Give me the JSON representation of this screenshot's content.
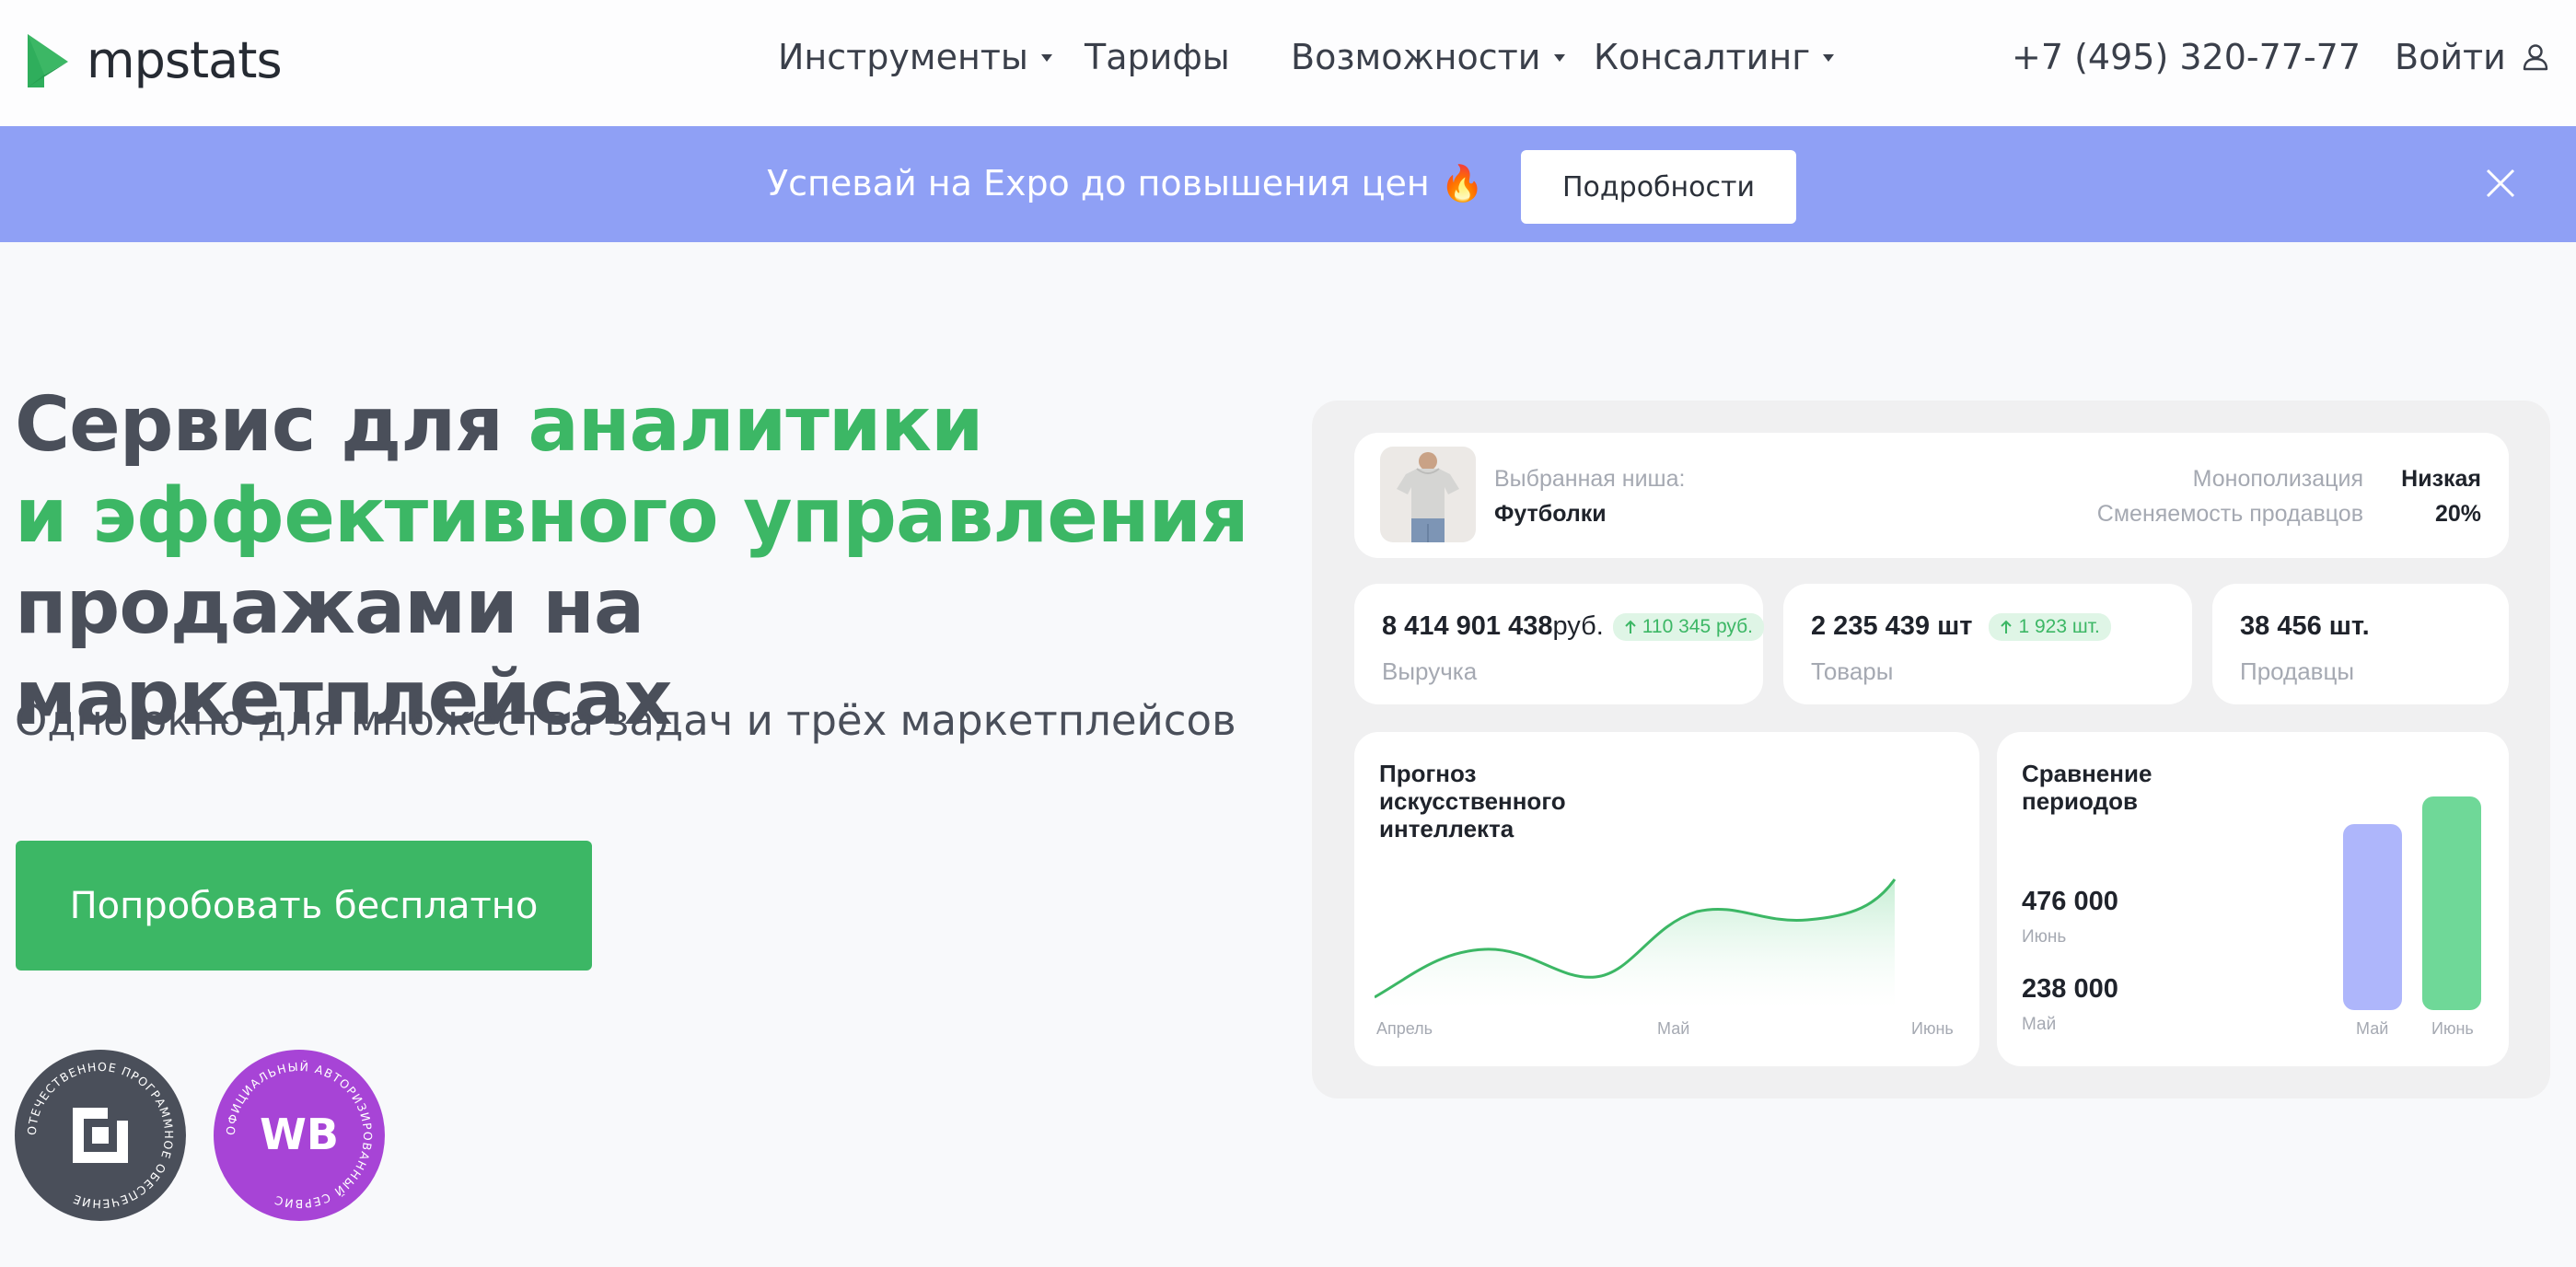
{
  "nav": {
    "brand": "mpstats",
    "items": [
      {
        "label": "Инструменты",
        "has_dropdown": true
      },
      {
        "label": "Тарифы",
        "has_dropdown": false
      },
      {
        "label": "Возможности",
        "has_dropdown": true
      },
      {
        "label": "Консалтинг",
        "has_dropdown": true
      }
    ],
    "phone": "+7 (495) 320-77-77",
    "login": "Войти"
  },
  "promo": {
    "text": "Успевай на Expo до повышения цен 🔥",
    "button": "Подробности"
  },
  "hero": {
    "title_part1": "Сервис для ",
    "title_accent1": "аналитики",
    "title_accent2": "и эффективного управления",
    "title_part2": "продажами на маркетплейсах",
    "subtitle": "Одно окно для множества задач и трёх маркетплейсов",
    "cta": "Попробовать бесплатно"
  },
  "badges": {
    "domestic_ring": "ОТЕЧЕСТВЕННОЕ ПРОГРАММНОЕ ОБЕСПЕЧЕНИЕ",
    "wb_ring": "ОФИЦИАЛЬНЫЙ АВТОРИЗИРОВАННЫЙ СЕРВИС",
    "wb_logo": "WB"
  },
  "dashboard": {
    "niche_label": "Выбранная ниша:",
    "niche_value": "Футболки",
    "monopoly_label": "Монополизация",
    "monopoly_value": "Низкая",
    "turnover_label": "Сменяемость продавцов",
    "turnover_value": "20%",
    "metrics": [
      {
        "value": "8 414 901 438",
        "unit": " руб.",
        "delta": "110 345 руб.",
        "label": "Выручка"
      },
      {
        "value": "2 235 439 шт",
        "unit": "",
        "delta": "1 923 шт.",
        "label": "Товары"
      },
      {
        "value": "38 456 шт.",
        "unit": "",
        "delta": "",
        "label": "Продавцы"
      }
    ],
    "forecast": {
      "title": "Прогноз искусственного интеллекта",
      "x_labels": [
        "Апрель",
        "Май",
        "Июнь"
      ]
    },
    "comparison": {
      "title": "Сравнение периодов",
      "value_june": "476 000",
      "label_june": "Июнь",
      "value_may": "238 000",
      "label_may": "Май",
      "bar_labels": [
        "Май",
        "Июнь"
      ]
    }
  },
  "colors": {
    "accent_green": "#3cb765",
    "promo_bg": "#8fa0f5",
    "text_dark": "#4a4f5a",
    "bar_may": "#aeb6fb",
    "bar_june": "#6fd898"
  }
}
